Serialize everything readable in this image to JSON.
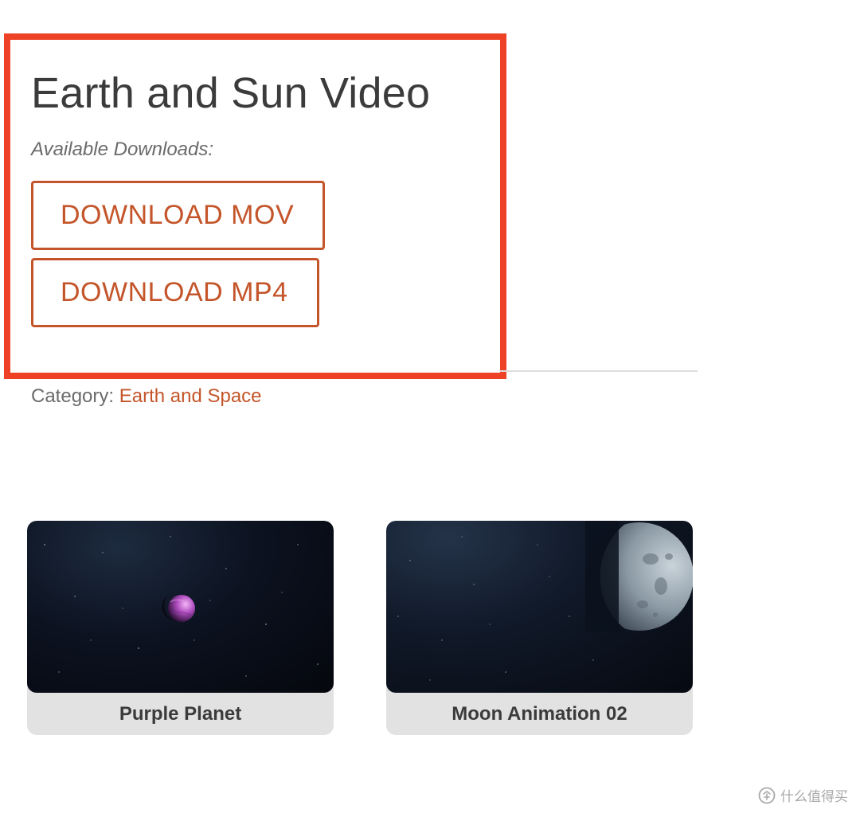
{
  "page": {
    "title": "Earth and Sun Video",
    "downloads_label": "Available Downloads:",
    "buttons": {
      "mov": "DOWNLOAD MOV",
      "mp4": "DOWNLOAD MP4"
    },
    "category": {
      "label": "Category:",
      "value": "Earth and Space"
    }
  },
  "related": [
    {
      "title": "Purple Planet",
      "thumbnail": "purple-planet-space-scene"
    },
    {
      "title": "Moon Animation 02",
      "thumbnail": "moon-space-scene"
    }
  ],
  "watermark": {
    "text": "什么值得买",
    "icon": "smzdm-logo-icon"
  },
  "colors": {
    "accent": "#c4552a",
    "highlight": "#ee4226",
    "text": "#3b3b3b",
    "muted": "#6b6b6b",
    "card_footer": "#e2e2e2"
  }
}
